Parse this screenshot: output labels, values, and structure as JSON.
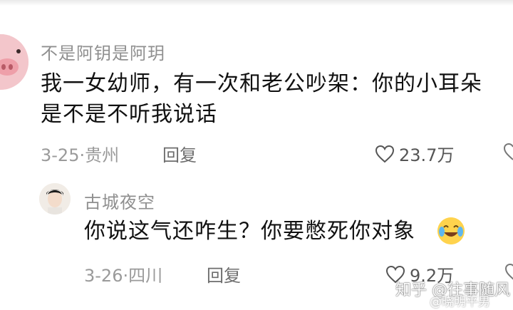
{
  "comments": [
    {
      "username": "不是阿钥是阿玥",
      "text_line1": "我一女幼师，有一次和老公吵架：你的小耳朵",
      "text_line2": "是不是不听我说话",
      "meta": "3-25·贵州",
      "reply_label": "回复",
      "likes": "23.7万",
      "avatar_icon": "pig-avatar-icon"
    },
    {
      "username": "古城夜空",
      "text": "你说这气还咋生？你要憋死你对象",
      "meta": "3-26·四川",
      "reply_label": "回复",
      "likes": "9.2万",
      "avatar_icon": "man-avatar-icon",
      "emoji": "laugh-cry-emoji-icon"
    }
  ],
  "watermark": {
    "line1": "知乎 @往事随风",
    "line2": "@晓明平男"
  },
  "colors": {
    "username": "#8f8f8f",
    "text": "#111111",
    "meta": "#9a9a9a",
    "reply": "#6d6d6d"
  }
}
